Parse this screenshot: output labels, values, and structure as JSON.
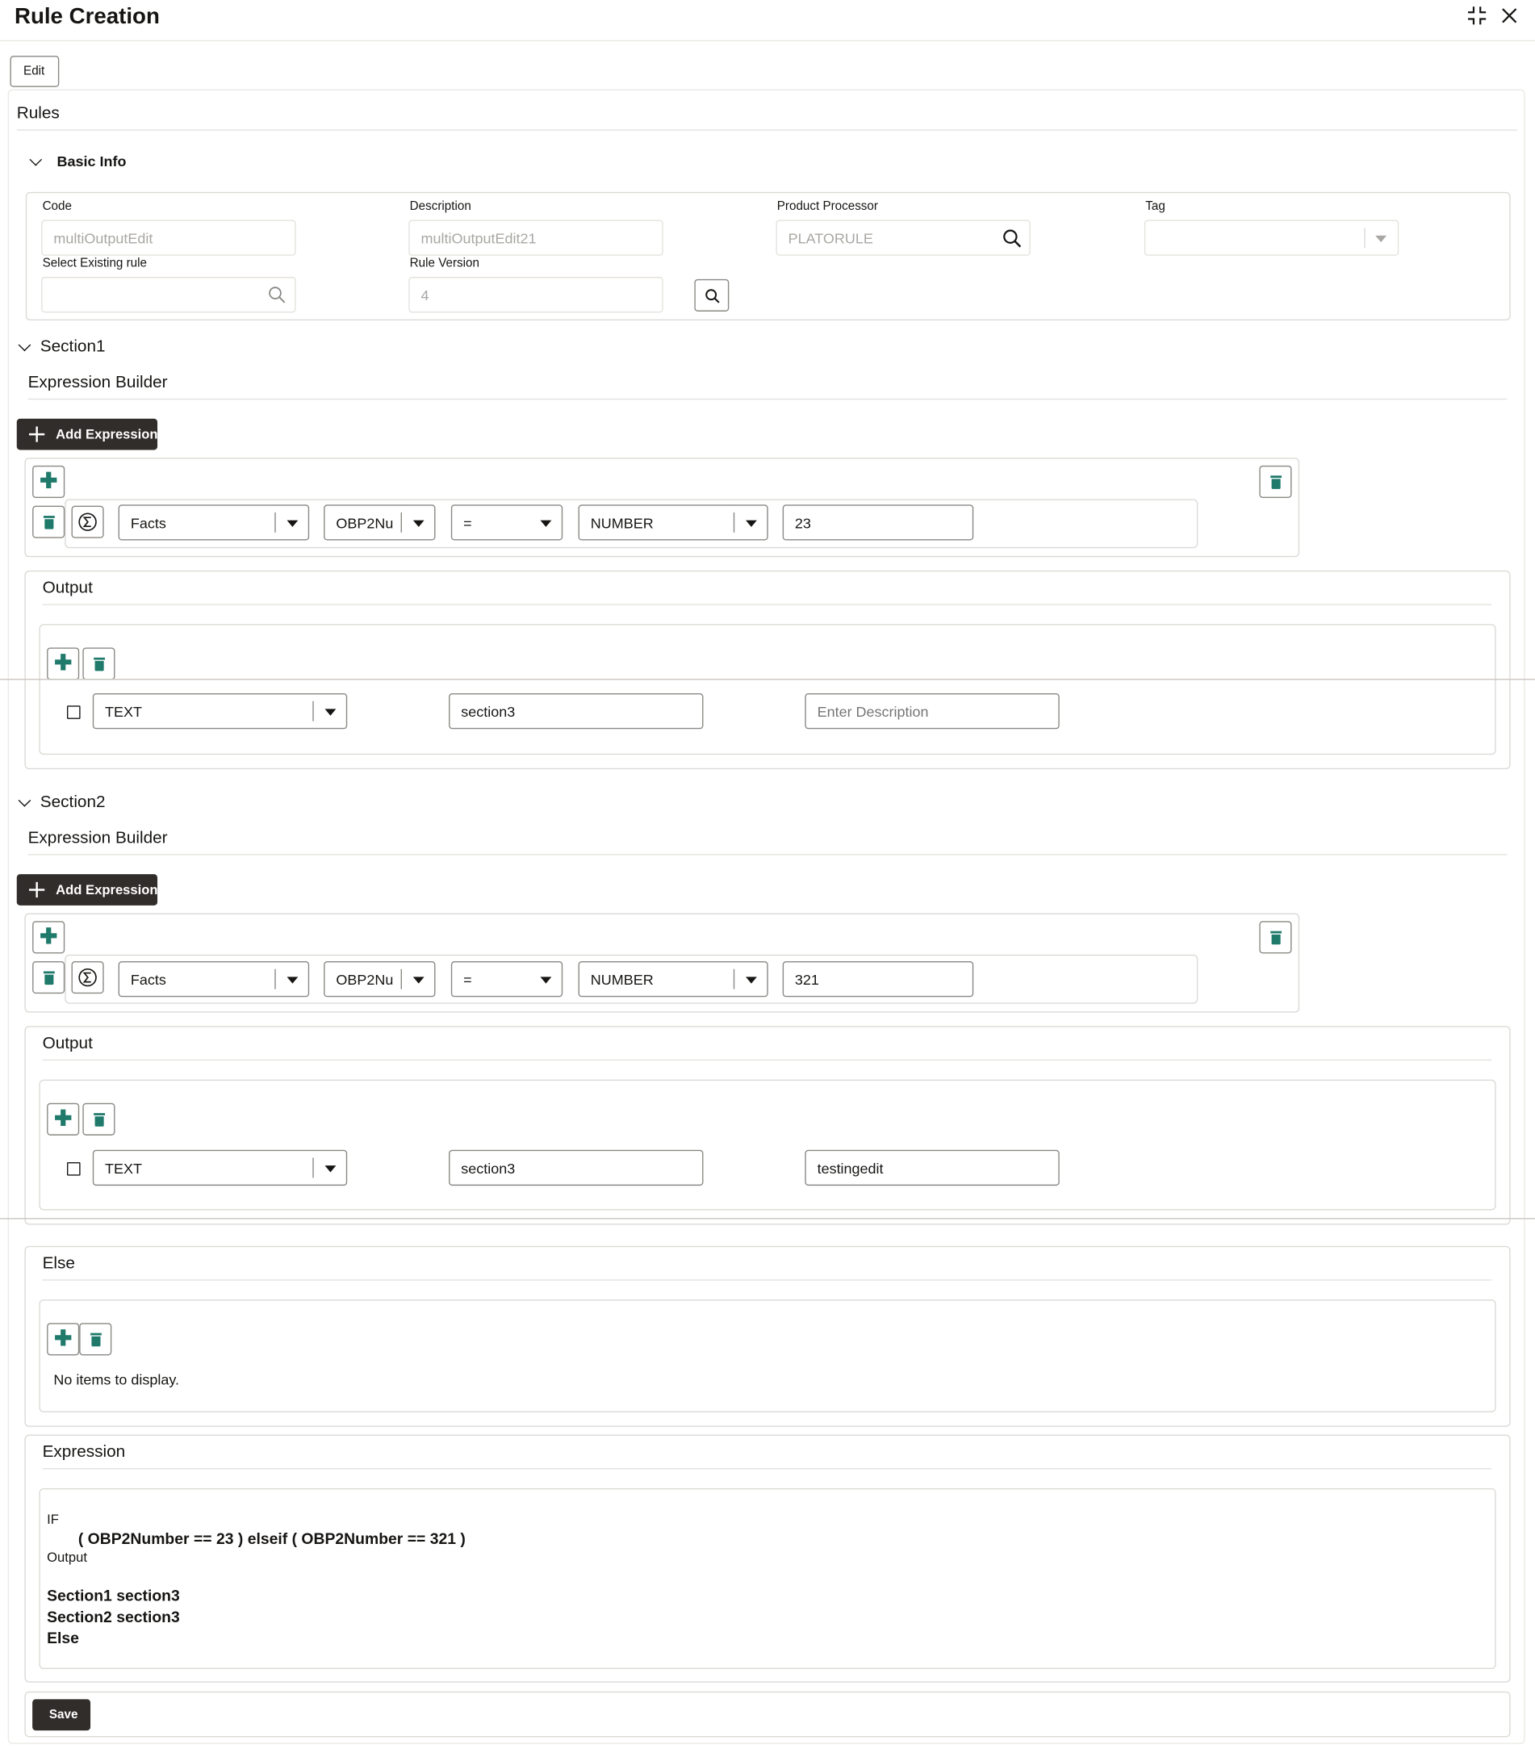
{
  "window": {
    "title": "Rule Creation"
  },
  "toolbar": {
    "edit_label": "Edit"
  },
  "rules": {
    "header": "Rules"
  },
  "basic_info": {
    "header": "Basic Info",
    "code_label": "Code",
    "code_value": "multiOutputEdit",
    "description_label": "Description",
    "description_value": "multiOutputEdit21",
    "product_processor_label": "Product Processor",
    "product_processor_value": "PLATORULE",
    "tag_label": "Tag",
    "tag_value": "",
    "select_existing_label": "Select Existing rule",
    "select_existing_value": "",
    "rule_version_label": "Rule Version",
    "rule_version_value": "4"
  },
  "section1": {
    "header": "Section1",
    "expression_builder_label": "Expression Builder",
    "add_expression_label": "Add Expression",
    "condition": {
      "fact_type": "Facts",
      "fact": "OBP2Nu",
      "operator": "=",
      "data_type": "NUMBER",
      "value": "23"
    },
    "output": {
      "header": "Output",
      "type": "TEXT",
      "value": "section3",
      "description": "",
      "description_placeholder": "Enter Description"
    }
  },
  "section2": {
    "header": "Section2",
    "expression_builder_label": "Expression Builder",
    "add_expression_label": "Add Expression",
    "condition": {
      "fact_type": "Facts",
      "fact": "OBP2Nu",
      "operator": "=",
      "data_type": "NUMBER",
      "value": "321"
    },
    "output": {
      "header": "Output",
      "type": "TEXT",
      "value": "section3",
      "description": "testingedit",
      "description_placeholder": "Enter Description"
    }
  },
  "else_section": {
    "header": "Else",
    "empty_text": "No items to display."
  },
  "expression_summary": {
    "header": "Expression",
    "if_label": "IF",
    "condition": "( OBP2Number == 23 ) elseif ( OBP2Number == 321 )",
    "output_label": "Output",
    "outputs": [
      "Section1 section3",
      "Section2 section3",
      "Else"
    ]
  },
  "footer": {
    "save_label": "Save"
  },
  "colors": {
    "accent": "#1f7a6b",
    "dark_button": "#312d2a",
    "border": "#dcdad6"
  },
  "icons": {
    "collapse": "collapse-icon",
    "close": "close-icon",
    "search": "search-icon",
    "add": "plus-icon",
    "delete": "trash-icon",
    "formula": "sigma-icon"
  }
}
